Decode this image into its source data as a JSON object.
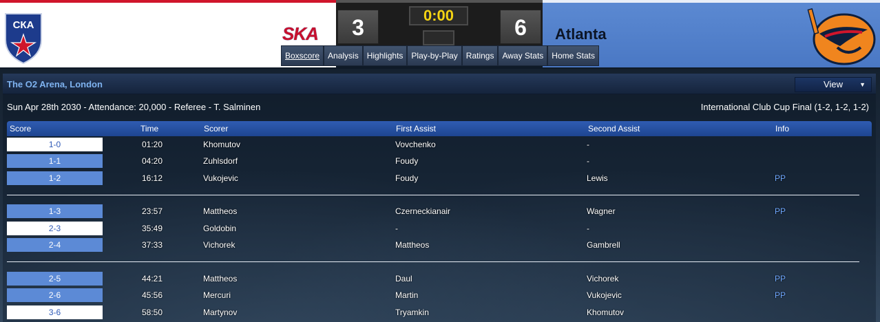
{
  "home": {
    "abbr": "SKA",
    "score": "3",
    "logo_text": "СКА",
    "primary_color": "#d0152b"
  },
  "away": {
    "name": "Atlanta",
    "score": "6",
    "panel_color": "#5b89d2"
  },
  "clock": "0:00",
  "tabs": [
    {
      "label": "Boxscore",
      "active": true
    },
    {
      "label": "Analysis"
    },
    {
      "label": "Highlights"
    },
    {
      "label": "Play-by-Play"
    },
    {
      "label": "Ratings"
    },
    {
      "label": "Away Stats"
    },
    {
      "label": "Home Stats"
    }
  ],
  "venue": "The O2 Arena, London",
  "view_button": "View",
  "game_info": "Sun Apr 28th 2030 - Attendance: 20,000 - Referee - T. Salminen",
  "competition": "International Club Cup Final (1-2, 1-2, 1-2)",
  "columns": [
    "Score",
    "Time",
    "Scorer",
    "First Assist",
    "Second Assist",
    "Info"
  ],
  "goals": [
    {
      "score": "1-0",
      "time": "01:20",
      "scorer": "Khomutov",
      "first_assist": "Vovchenko",
      "second_assist": "-",
      "info": "",
      "team": "home"
    },
    {
      "score": "1-1",
      "time": "04:20",
      "scorer": "Zuhlsdorf",
      "first_assist": "Foudy",
      "second_assist": "-",
      "info": "",
      "team": "away"
    },
    {
      "score": "1-2",
      "time": "16:12",
      "scorer": "Vukojevic",
      "first_assist": "Foudy",
      "second_assist": "Lewis",
      "info": "PP",
      "team": "away"
    },
    {
      "score": "1-3",
      "time": "23:57",
      "scorer": "Mattheos",
      "first_assist": "Czerneckianair",
      "second_assist": "Wagner",
      "info": "PP",
      "team": "away"
    },
    {
      "score": "2-3",
      "time": "35:49",
      "scorer": "Goldobin",
      "first_assist": "-",
      "second_assist": "-",
      "info": "",
      "team": "home"
    },
    {
      "score": "2-4",
      "time": "37:33",
      "scorer": "Vichorek",
      "first_assist": "Mattheos",
      "second_assist": "Gambrell",
      "info": "",
      "team": "away"
    },
    {
      "score": "2-5",
      "time": "44:21",
      "scorer": "Mattheos",
      "first_assist": "Daul",
      "second_assist": "Vichorek",
      "info": "PP",
      "team": "away"
    },
    {
      "score": "2-6",
      "time": "45:56",
      "scorer": "Mercuri",
      "first_assist": "Martin",
      "second_assist": "Vukojevic",
      "info": "PP",
      "team": "away"
    },
    {
      "score": "3-6",
      "time": "58:50",
      "scorer": "Martynov",
      "first_assist": "Tryamkin",
      "second_assist": "Khomutov",
      "info": "",
      "team": "home"
    }
  ]
}
